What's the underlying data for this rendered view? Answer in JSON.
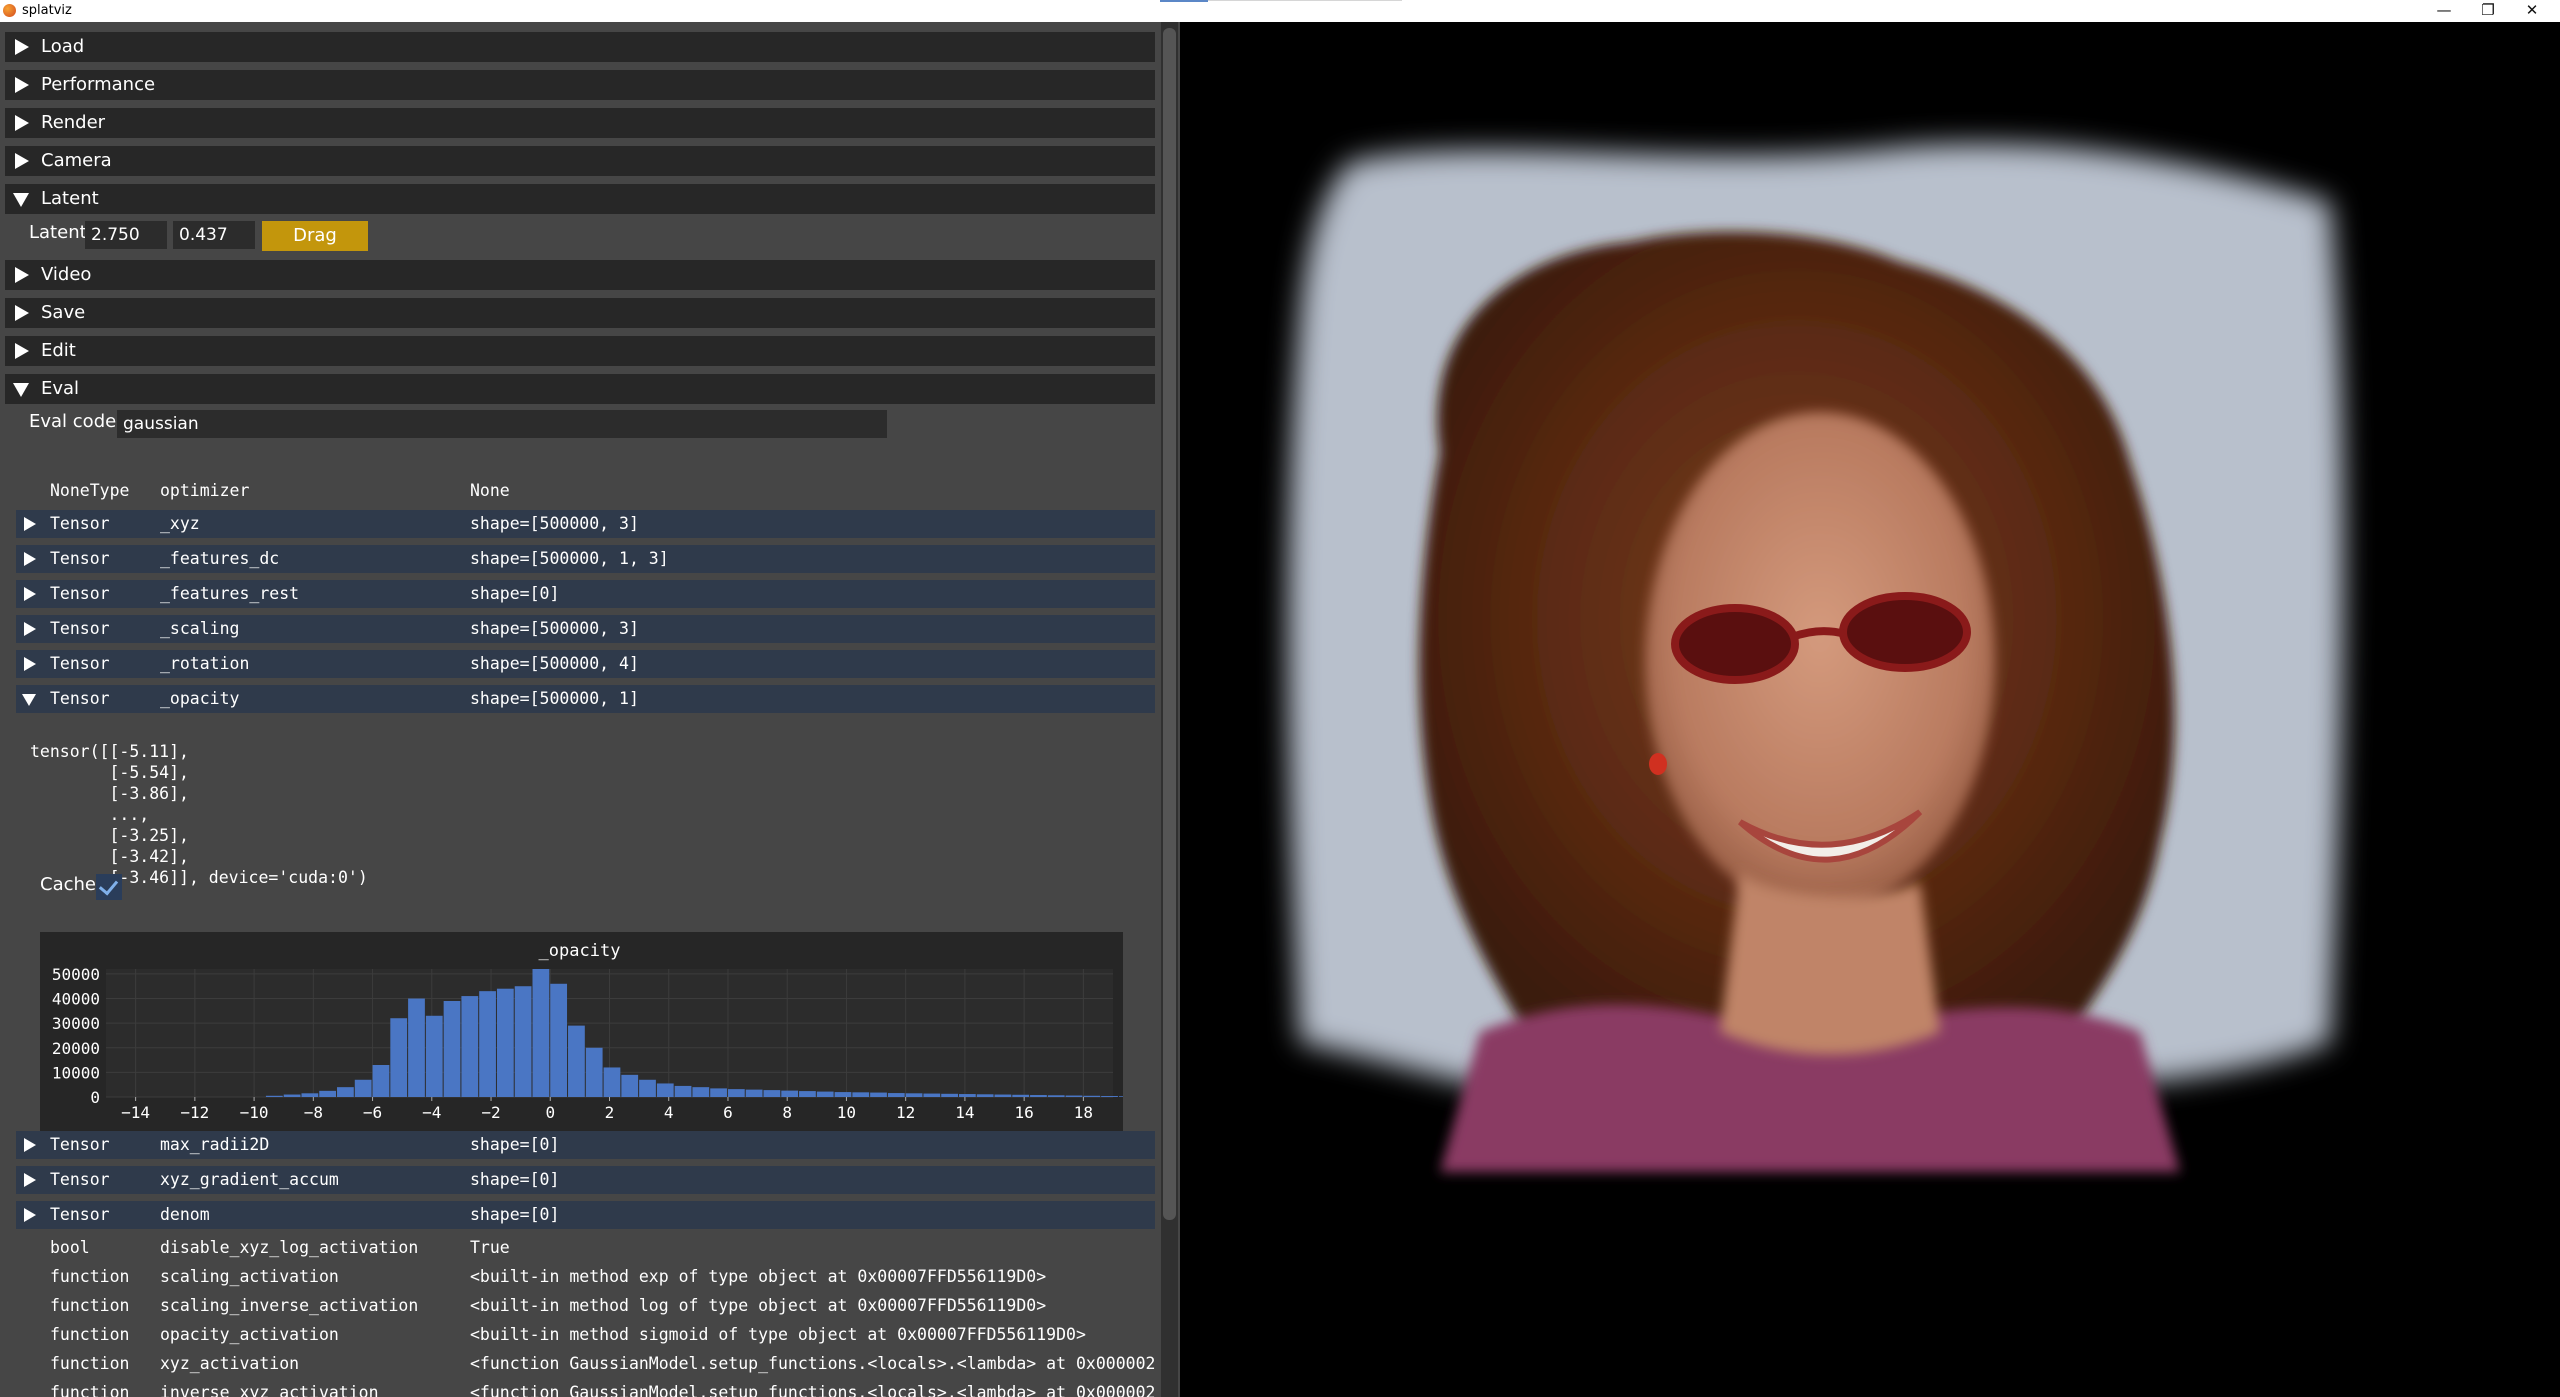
{
  "window": {
    "title": "splatviz",
    "minimize": "—",
    "restore": "❐",
    "close": "✕"
  },
  "sections": {
    "load": "Load",
    "performance": "Performance",
    "render": "Render",
    "camera": "Camera",
    "latent": "Latent",
    "video": "Video",
    "save": "Save",
    "edit": "Edit",
    "eval": "Eval"
  },
  "latent": {
    "label": "Latent",
    "x": "2.750",
    "y": "0.437",
    "drag_button": "Drag"
  },
  "eval": {
    "code_label": "Eval code:",
    "code_value": "gaussian"
  },
  "tree": {
    "header": {
      "type": "NoneType",
      "name": "optimizer",
      "value": "None"
    },
    "tensors_top": [
      {
        "type": "Tensor",
        "name": "_xyz",
        "value": "shape=[500000, 3]"
      },
      {
        "type": "Tensor",
        "name": "_features_dc",
        "value": "shape=[500000, 1, 3]"
      },
      {
        "type": "Tensor",
        "name": "_features_rest",
        "value": "shape=[0]"
      },
      {
        "type": "Tensor",
        "name": "_scaling",
        "value": "shape=[500000, 3]"
      },
      {
        "type": "Tensor",
        "name": "_rotation",
        "value": "shape=[500000, 4]"
      },
      {
        "type": "Tensor",
        "name": "_opacity",
        "value": "shape=[500000, 1]"
      }
    ],
    "opacity_tensor_text": "tensor([[-5.11],\n        [-5.54],\n        [-3.86],\n        ...,\n        [-3.25],\n        [-3.42],\n        [-3.46]], device='cuda:0')",
    "cache_label": "Cache",
    "cache_checked": true,
    "tensors_bottom": [
      {
        "type": "Tensor",
        "name": "max_radii2D",
        "value": "shape=[0]"
      },
      {
        "type": "Tensor",
        "name": "xyz_gradient_accum",
        "value": "shape=[0]"
      },
      {
        "type": "Tensor",
        "name": "denom",
        "value": "shape=[0]"
      }
    ],
    "plain": [
      {
        "type": "bool",
        "name": "disable_xyz_log_activation",
        "value": "True"
      },
      {
        "type": "function",
        "name": "scaling_activation",
        "value": "<built-in method exp of type object at 0x00007FFD556119D0>"
      },
      {
        "type": "function",
        "name": "scaling_inverse_activation",
        "value": "<built-in method log of type object at 0x00007FFD556119D0>"
      },
      {
        "type": "function",
        "name": "opacity_activation",
        "value": "<built-in method sigmoid of type object at 0x00007FFD556119D0>"
      },
      {
        "type": "function",
        "name": "xyz_activation",
        "value": "<function GaussianModel.setup_functions.<locals>.<lambda> at 0x000002"
      },
      {
        "type": "function",
        "name": "inverse_xyz_activation",
        "value": "<function GaussianModel.setup_functions.<locals>.<lambda> at 0x000002"
      }
    ]
  },
  "colors": {
    "bar": "#4a76c4",
    "panel": "#464646",
    "header": "#272727",
    "tensor_row": "#2f3a4b",
    "accent": "#c3960c"
  },
  "chart_data": {
    "type": "bar",
    "title": "_opacity",
    "xlabel": "",
    "ylabel": "",
    "xlim": [
      -15,
      19
    ],
    "ylim": [
      0,
      52000
    ],
    "yticks": [
      0,
      10000,
      20000,
      30000,
      40000,
      50000
    ],
    "xticks": [
      -14,
      -12,
      -10,
      -8,
      -6,
      -4,
      -2,
      0,
      2,
      4,
      6,
      8,
      10,
      12,
      14,
      16,
      18
    ],
    "bin_width": 0.6,
    "bin_start": -9.6,
    "values": [
      500,
      1000,
      1500,
      2500,
      4000,
      7000,
      13000,
      32000,
      40000,
      33000,
      39000,
      41000,
      43000,
      44000,
      45000,
      52000,
      46000,
      29000,
      20000,
      12000,
      9000,
      7000,
      5500,
      4500,
      4000,
      3500,
      3200,
      3000,
      2800,
      2600,
      2400,
      2200,
      2000,
      1900,
      1800,
      1600,
      1500,
      1400,
      1300,
      1200,
      1100,
      1000,
      900,
      800,
      700,
      600,
      500,
      400,
      300,
      200
    ],
    "grid": true
  }
}
